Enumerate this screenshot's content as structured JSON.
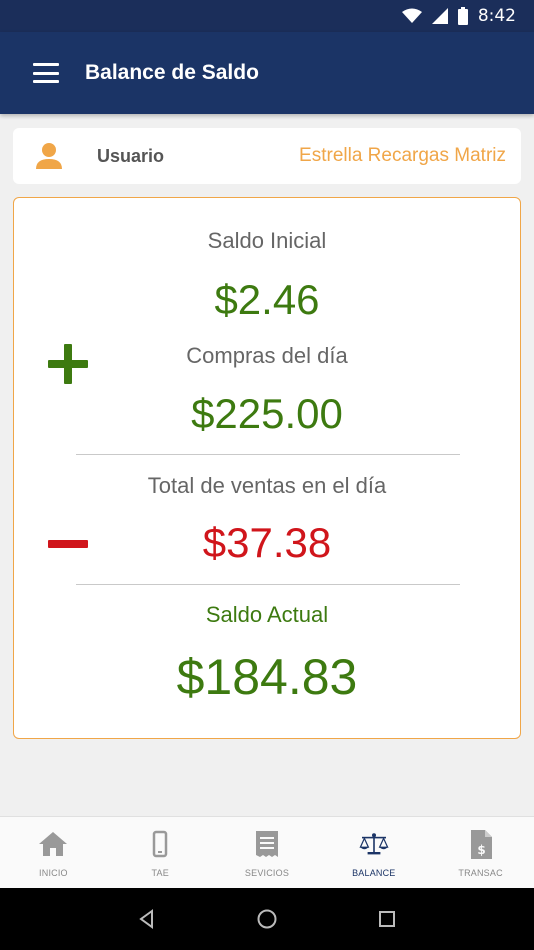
{
  "status_bar": {
    "time": "8:42"
  },
  "app_bar": {
    "title": "Balance de Saldo"
  },
  "user": {
    "label": "Usuario",
    "value": "Estrella Recargas Matriz"
  },
  "balance": {
    "saldo_inicial_label": "Saldo Inicial",
    "saldo_inicial": "$2.46",
    "compras_label": "Compras del día",
    "compras": "$225.00",
    "ventas_label": "Total de ventas en el día",
    "ventas": "$37.38",
    "saldo_actual_label": "Saldo Actual",
    "saldo_actual": "$184.83"
  },
  "colors": {
    "app_bar": "#1b3466",
    "accent_orange": "#f0a648",
    "positive_green": "#3d7a10",
    "negative_red": "#d0151b"
  },
  "bottom_nav": {
    "items": [
      {
        "label": "INICIO",
        "icon": "home-icon"
      },
      {
        "label": "TAE",
        "icon": "phone-icon"
      },
      {
        "label": "SEVICIOS",
        "icon": "receipt-icon"
      },
      {
        "label": "BALANCE",
        "icon": "scale-icon",
        "active": true
      },
      {
        "label": "TRANSAC",
        "icon": "dollar-document-icon"
      }
    ]
  }
}
